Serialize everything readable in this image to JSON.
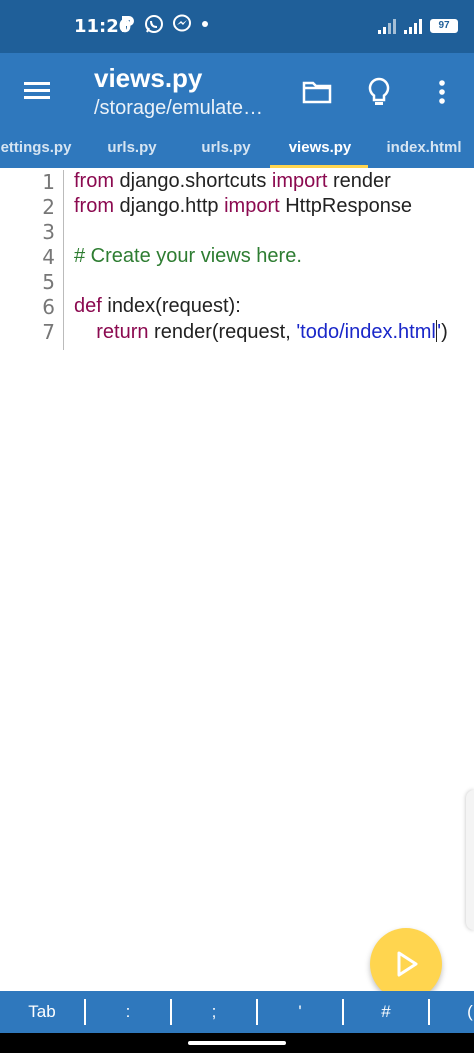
{
  "status": {
    "time": "11:20",
    "battery": "97",
    "icons_left": [
      "p-icon",
      "whatsapp-icon",
      "messenger-icon",
      "dot-icon"
    ],
    "icons_right": [
      "signal-icon",
      "signal-icon",
      "battery-icon"
    ]
  },
  "appbar": {
    "title": "views.py",
    "subtitle": "/storage/emulate…",
    "actions": [
      "folder-icon",
      "lightbulb-icon",
      "more-vert-icon"
    ]
  },
  "tabs": [
    {
      "label": "ettings.py",
      "active": false
    },
    {
      "label": "urls.py",
      "active": false
    },
    {
      "label": "urls.py",
      "active": false
    },
    {
      "label": "views.py",
      "active": true
    },
    {
      "label": "index.html",
      "active": false
    }
  ],
  "editor": {
    "line_numbers": [
      "1",
      "2",
      "3",
      "4",
      "5",
      "6",
      "7"
    ],
    "lines": [
      {
        "parts": [
          {
            "t": "kw",
            "v": "from"
          },
          {
            "t": "n",
            "v": " django.shortcuts "
          },
          {
            "t": "kw",
            "v": "import"
          },
          {
            "t": "n",
            "v": " render"
          }
        ]
      },
      {
        "parts": [
          {
            "t": "kw",
            "v": "from"
          },
          {
            "t": "n",
            "v": " django.http "
          },
          {
            "t": "kw",
            "v": "import"
          },
          {
            "t": "n",
            "v": " HttpResponse"
          }
        ]
      },
      {
        "parts": []
      },
      {
        "parts": [
          {
            "t": "cm",
            "v": "# Create your views here."
          }
        ]
      },
      {
        "parts": []
      },
      {
        "parts": [
          {
            "t": "kw",
            "v": "def"
          },
          {
            "t": "n",
            "v": " index(request):"
          }
        ]
      },
      {
        "parts": [
          {
            "t": "n",
            "v": "    "
          },
          {
            "t": "kw",
            "v": "return"
          },
          {
            "t": "n",
            "v": " render(request, "
          },
          {
            "t": "str",
            "v": "'todo/index.html"
          },
          {
            "t": "cursor",
            "v": ""
          },
          {
            "t": "str",
            "v": "'"
          },
          {
            "t": "n",
            "v": ")"
          }
        ]
      }
    ]
  },
  "symbols": [
    "Tab",
    ":",
    ";",
    "'",
    "#",
    "("
  ],
  "colors": {
    "statusbar": "#1f5f99",
    "primary": "#2f78bd",
    "accent": "#ffd54f",
    "keyword": "#8b0a50",
    "comment": "#2e7d32",
    "string": "#1a27c9"
  }
}
